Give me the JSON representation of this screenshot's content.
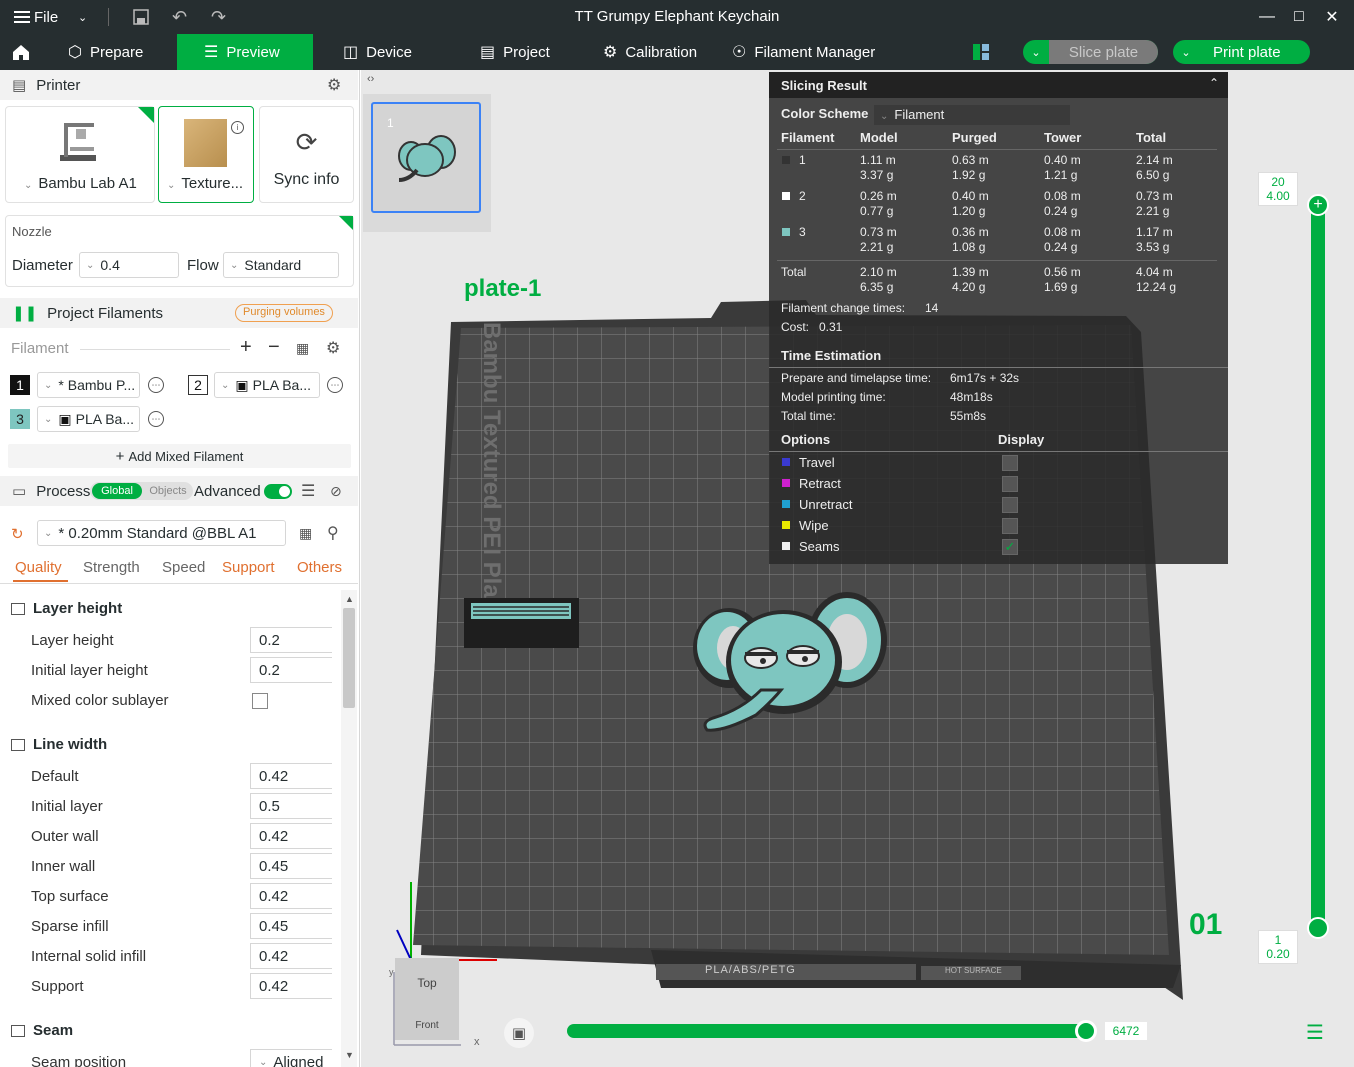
{
  "window": {
    "title": "TT Grumpy Elephant Keychain",
    "file_menu": "File"
  },
  "tabs": [
    {
      "label": "Prepare",
      "active": false
    },
    {
      "label": "Preview",
      "active": true
    },
    {
      "label": "Device",
      "active": false
    },
    {
      "label": "Project",
      "active": false
    },
    {
      "label": "Calibration",
      "active": false
    },
    {
      "label": "Filament Manager",
      "active": false
    }
  ],
  "actions": {
    "slice": "Slice plate",
    "print": "Print plate"
  },
  "colors": {
    "accent": "#00ae42",
    "dark": "#262e30",
    "filament3": "#7ec6c0"
  },
  "printer": {
    "header": "Printer",
    "model": "Bambu Lab A1",
    "plate": "Texture...",
    "sync": "Sync info",
    "nozzle_label": "Nozzle",
    "diameter_label": "Diameter",
    "diameter_value": "0.4",
    "flow_label": "Flow",
    "flow_value": "Standard"
  },
  "filaments": {
    "header": "Project Filaments",
    "purging_badge": "Purging volumes",
    "placeholder": "Filament",
    "items": [
      {
        "num": "1",
        "name": "* Bambu P...",
        "color": "#111111"
      },
      {
        "num": "2",
        "name": "PLA Ba...",
        "color": "#ffffff"
      },
      {
        "num": "3",
        "name": "PLA Ba...",
        "color": "#7ec6c0"
      }
    ],
    "add_mixed": "Add Mixed Filament"
  },
  "process": {
    "header": "Process",
    "toggle_global": "Global",
    "toggle_objects": "Objects",
    "advanced": "Advanced",
    "preset": "* 0.20mm Standard @BBL A1",
    "tabs": [
      "Quality",
      "Strength",
      "Speed",
      "Support",
      "Others"
    ],
    "groups": [
      {
        "title": "Layer height",
        "rows": [
          {
            "label": "Layer height",
            "value": "0.2"
          },
          {
            "label": "Initial layer height",
            "value": "0.2"
          },
          {
            "label": "Mixed color sublayer",
            "value": ""
          }
        ]
      },
      {
        "title": "Line width",
        "rows": [
          {
            "label": "Default",
            "value": "0.42"
          },
          {
            "label": "Initial layer",
            "value": "0.5"
          },
          {
            "label": "Outer wall",
            "value": "0.42"
          },
          {
            "label": "Inner wall",
            "value": "0.45"
          },
          {
            "label": "Top surface",
            "value": "0.42"
          },
          {
            "label": "Sparse infill",
            "value": "0.45"
          },
          {
            "label": "Internal solid infill",
            "value": "0.42"
          },
          {
            "label": "Support",
            "value": "0.42"
          }
        ]
      },
      {
        "title": "Seam",
        "rows": [
          {
            "label": "Seam position",
            "value": "Aligned"
          }
        ]
      }
    ]
  },
  "viewport": {
    "plate_label": "plate-1",
    "plate_brand": "Bambu Textured PEI Pla",
    "plate_number": "01",
    "thumbnail_index": "1",
    "bed_strip": "PLA/ABS/PETG",
    "bed_strip_right": "HOT SURFACE",
    "view_cube_top": "Top",
    "view_cube_front": "Front",
    "axis_x": "x",
    "axis_y": "y"
  },
  "slicing_result": {
    "title": "Slicing Result",
    "color_scheme_label": "Color Scheme",
    "color_scheme_value": "Filament",
    "columns": [
      "Filament",
      "Model",
      "Purged",
      "Tower",
      "Total"
    ],
    "rows": [
      {
        "id": "1",
        "color": "#333333",
        "model": [
          "1.11 m",
          "3.37 g"
        ],
        "purged": [
          "0.63 m",
          "1.92 g"
        ],
        "tower": [
          "0.40 m",
          "1.21 g"
        ],
        "total": [
          "2.14 m",
          "6.50 g"
        ]
      },
      {
        "id": "2",
        "color": "#ffffff",
        "model": [
          "0.26 m",
          "0.77 g"
        ],
        "purged": [
          "0.40 m",
          "1.20 g"
        ],
        "tower": [
          "0.08 m",
          "0.24 g"
        ],
        "total": [
          "0.73 m",
          "2.21 g"
        ]
      },
      {
        "id": "3",
        "color": "#7ec6c0",
        "model": [
          "0.73 m",
          "2.21 g"
        ],
        "purged": [
          "0.36 m",
          "1.08 g"
        ],
        "tower": [
          "0.08 m",
          "0.24 g"
        ],
        "total": [
          "1.17 m",
          "3.53 g"
        ]
      }
    ],
    "total": {
      "label": "Total",
      "model": [
        "2.10 m",
        "6.35 g"
      ],
      "purged": [
        "1.39 m",
        "4.20 g"
      ],
      "tower": [
        "0.56 m",
        "1.69 g"
      ],
      "total": [
        "4.04 m",
        "12.24 g"
      ]
    },
    "change_times_label": "Filament change times:",
    "change_times": "14",
    "cost_label": "Cost:",
    "cost": "0.31",
    "time_header": "Time Estimation",
    "prepare_label": "Prepare and timelapse time:",
    "prepare_value": "6m17s + 32s",
    "model_time_label": "Model printing time:",
    "model_time_value": "48m18s",
    "total_time_label": "Total time:",
    "total_time_value": "55m8s",
    "options_label": "Options",
    "display_label": "Display",
    "options": [
      {
        "label": "Travel",
        "color": "#3a3ad0",
        "checked": false
      },
      {
        "label": "Retract",
        "color": "#d020d0",
        "checked": false
      },
      {
        "label": "Unretract",
        "color": "#20a0d0",
        "checked": false
      },
      {
        "label": "Wipe",
        "color": "#e8e800",
        "checked": false
      },
      {
        "label": "Seams",
        "color": "#f0f0f0",
        "checked": true
      }
    ]
  },
  "layer_slider": {
    "top_layer": "20",
    "top_height": "4.00",
    "bottom_layer": "1",
    "bottom_height": "0.20"
  },
  "move_slider": {
    "value": "6472"
  }
}
